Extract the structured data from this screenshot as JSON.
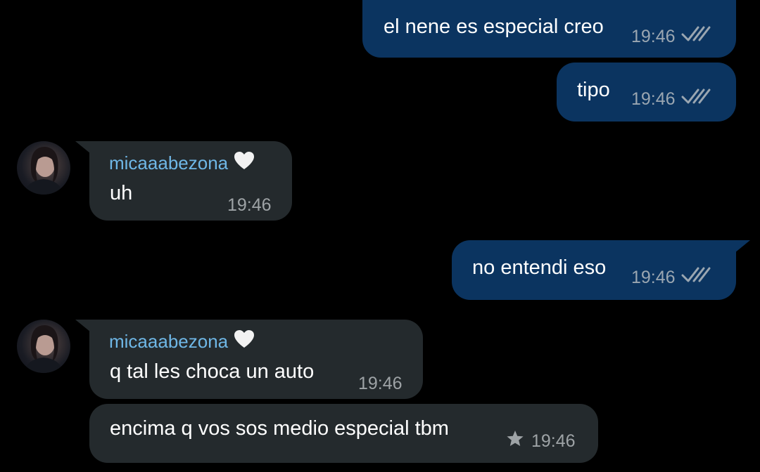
{
  "contact": {
    "name": "micaaabezona",
    "emoji": "🤍"
  },
  "messages": [
    {
      "direction": "outgoing",
      "text": "el nene es especial creo",
      "time": "19:46",
      "status": "read"
    },
    {
      "direction": "outgoing",
      "text": "tipo",
      "time": "19:46",
      "status": "read"
    },
    {
      "direction": "incoming",
      "sender": "micaaabezona",
      "text": "uh",
      "time": "19:46"
    },
    {
      "direction": "outgoing",
      "text": "no entendi eso",
      "time": "19:46",
      "status": "read"
    },
    {
      "direction": "incoming",
      "sender": "micaaabezona",
      "text": "q tal les choca un auto",
      "time": "19:46"
    },
    {
      "direction": "incoming",
      "text": "encima q vos sos medio especial tbm",
      "time": "19:46",
      "starred": true
    }
  ],
  "icons": {
    "read_receipt": "double-check-icon",
    "starred": "star-icon",
    "emoji": "white-heart-icon"
  },
  "colors": {
    "background": "#000000",
    "outgoing_bubble": "#0b3460",
    "incoming_bubble": "#242a2d",
    "sender_name": "#6fb7e6",
    "meta_text": "#9aa6b1"
  }
}
